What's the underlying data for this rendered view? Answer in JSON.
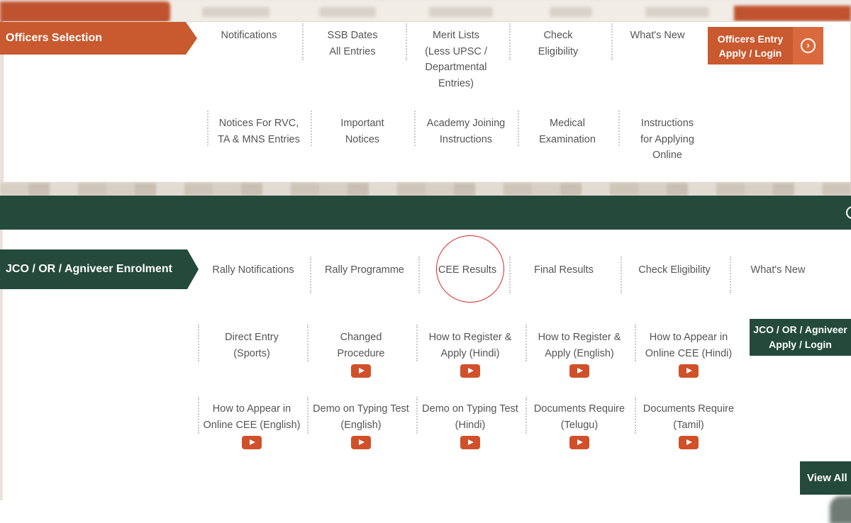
{
  "colors": {
    "officers_accent": "#c9592f",
    "enrolment_accent": "#244a3c",
    "play_icon": "#d0502a",
    "highlight_circle": "#d9262b"
  },
  "officers": {
    "label": "Officers Selection",
    "row1": [
      {
        "label": "Notifications"
      },
      {
        "label": "SSB Dates\nAll Entries"
      },
      {
        "label": "Merit Lists\n(Less UPSC /\nDepartmental\nEntries)"
      },
      {
        "label": "Check\nEligibility"
      },
      {
        "label": "What's New"
      }
    ],
    "row2": [
      {
        "label": "Notices For RVC,\nTA & MNS Entries"
      },
      {
        "label": "Important\nNotices"
      },
      {
        "label": "Academy Joining\nInstructions"
      },
      {
        "label": "Medical\nExamination"
      },
      {
        "label": "Instructions\nfor Applying\nOnline"
      }
    ],
    "apply_button": {
      "label": "Officers Entry\nApply / Login",
      "icon": "chevron-right-circle-icon"
    }
  },
  "enrolment": {
    "label": "JCO / OR / Agniveer Enrolment",
    "row1": [
      {
        "label": "Rally Notifications"
      },
      {
        "label": "Rally Programme"
      },
      {
        "label": "CEE Results"
      },
      {
        "label": "Final Results"
      },
      {
        "label": "Check Eligibility"
      },
      {
        "label": "What's New"
      }
    ],
    "row2": [
      {
        "label": "Direct Entry\n(Sports)",
        "has_video": false
      },
      {
        "label": "Changed\nProcedure",
        "has_video": true
      },
      {
        "label": "How to Register &\nApply (Hindi)",
        "has_video": true
      },
      {
        "label": "How to Register &\nApply (English)",
        "has_video": true
      },
      {
        "label": "How to Appear in\nOnline CEE (Hindi)",
        "has_video": true
      }
    ],
    "row3": [
      {
        "label": "How to Appear in\nOnline CEE (English)",
        "has_video": true
      },
      {
        "label": "Demo on Typing Test\n(English)",
        "has_video": true
      },
      {
        "label": "Demo on Typing Test\n(Hindi)",
        "has_video": true
      },
      {
        "label": "Documents Require\n(Telugu)",
        "has_video": true
      },
      {
        "label": "Documents Require\n(Tamil)",
        "has_video": true
      }
    ],
    "apply_button": {
      "label": "JCO / OR / Agniveer\nApply / Login"
    },
    "view_all": "View All",
    "highlighted_item": "CEE Results"
  }
}
